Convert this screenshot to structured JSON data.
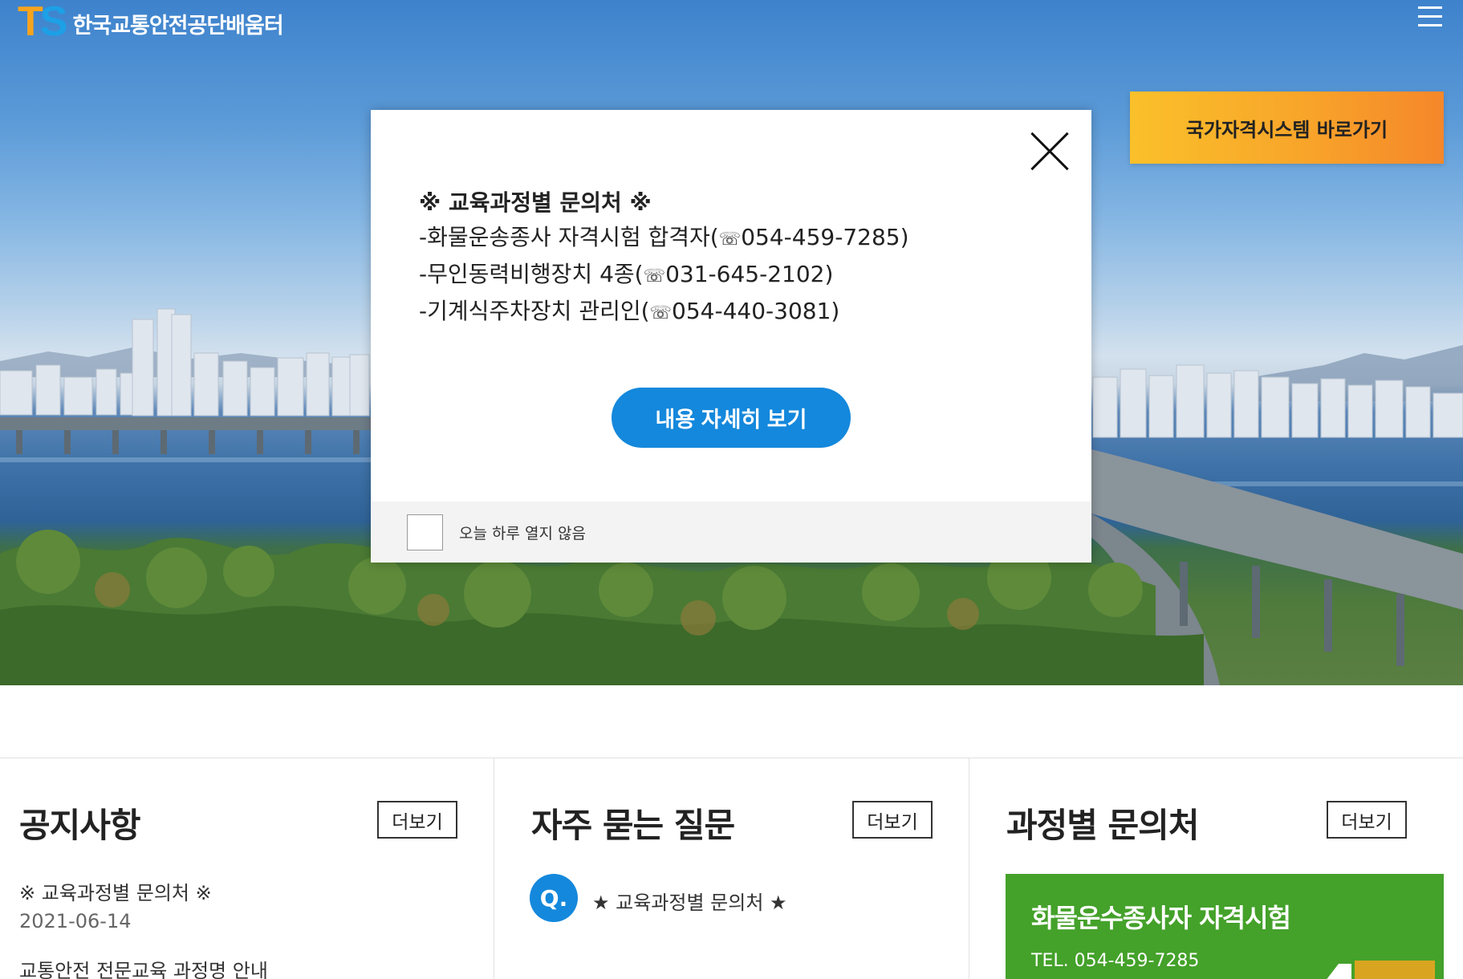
{
  "header": {
    "logo_mark_t": "T",
    "logo_mark_s": "S",
    "logo_text": "한국교통안전공단배움터",
    "menu_icon": "hamburger-menu-icon"
  },
  "hero": {
    "nqs_button": "국가자격시스템 바로가기"
  },
  "popup": {
    "title": "※ 교육과정별 문의처 ※",
    "phone_glyph": "☏",
    "lines": [
      {
        "text": "-화물운송종사 자격시험 합격자(",
        "phone": "054-459-7285)"
      },
      {
        "text": "-무인동력비행장치 4종(",
        "phone": "031-645-2102)"
      },
      {
        "text": "-기계식주차장치 관리인(",
        "phone": "054-440-3081)"
      }
    ],
    "detail_button": "내용 자세히 보기",
    "dont_show_today": "오늘 하루 열지 않음"
  },
  "notice": {
    "title": "공지사항",
    "more": "더보기",
    "items": [
      {
        "title": "※ 교육과정별 문의처 ※",
        "date": "2021-06-14"
      },
      {
        "title": "교통안전 전문교육 과정명 안내"
      }
    ]
  },
  "faq": {
    "title": "자주 묻는 질문",
    "more": "더보기",
    "badge": "Q.",
    "items": [
      {
        "title": "★ 교육과정별 문의처 ★"
      }
    ]
  },
  "contacts": {
    "title": "과정별 문의처",
    "more": "더보기",
    "card": {
      "title": "화물운수종사자 자격시험",
      "tel": "TEL. 054-459-7285",
      "color": "#44a12a"
    }
  },
  "colors": {
    "accent_blue": "#1488dc",
    "nqs_orange": "#f8a52a",
    "logo_orange": "#f7a41d",
    "logo_blue": "#1da0e6"
  }
}
